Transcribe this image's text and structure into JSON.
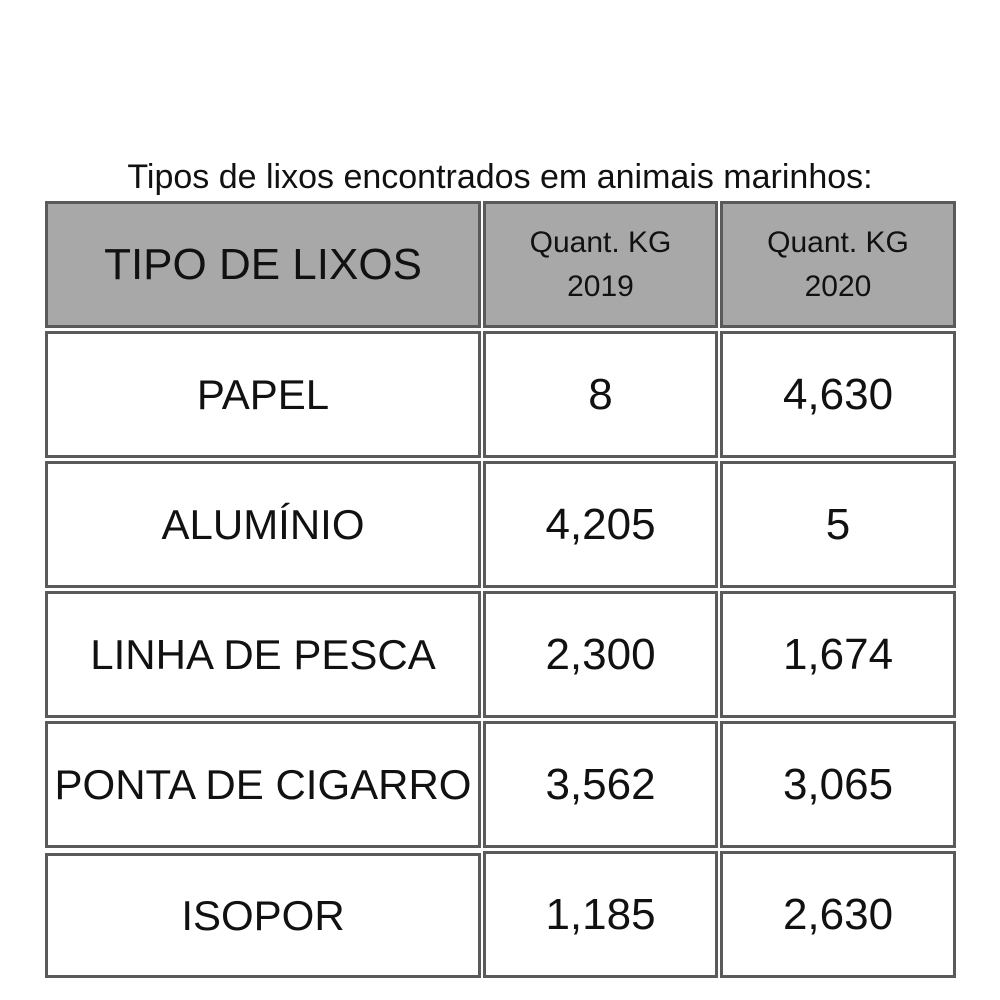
{
  "caption": "Tipos de lixos encontrados em animais marinhos:",
  "table": {
    "headers": {
      "type": "TIPO DE LIXOS",
      "col2019_line1": "Quant. KG",
      "col2019_line2": "2019",
      "col2020_line1": "Quant. KG",
      "col2020_line2": "2020"
    },
    "rows": [
      {
        "type": "PAPEL",
        "y2019": "8",
        "y2020": "4,630"
      },
      {
        "type": "ALUMÍNIO",
        "y2019": "4,205",
        "y2020": "5"
      },
      {
        "type": "LINHA DE PESCA",
        "y2019": "2,300",
        "y2020": "1,674"
      },
      {
        "type": "PONTA DE CIGARRO",
        "y2019": "3,562",
        "y2020": "3,065"
      },
      {
        "type": "ISOPOR",
        "y2019": "1,185",
        "y2020": "2,630"
      }
    ]
  },
  "colors": {
    "header_background": "#a8a8a8",
    "border": "#5a5a5a",
    "cell_background": "#ffffff",
    "text": "#111111"
  }
}
